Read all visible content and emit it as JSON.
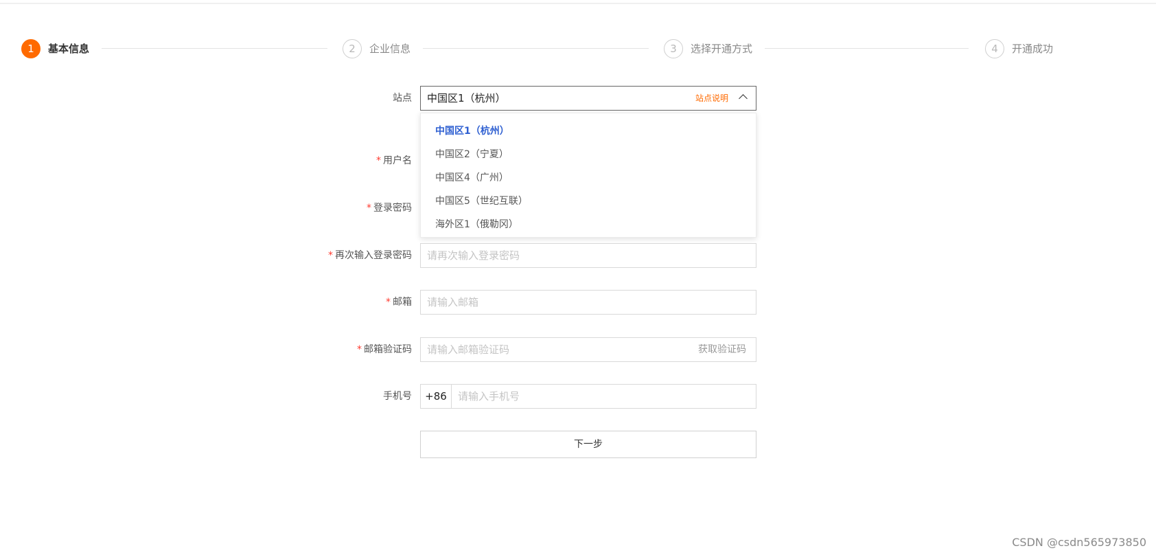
{
  "steps": [
    {
      "number": "1",
      "label": "基本信息"
    },
    {
      "number": "2",
      "label": "企业信息"
    },
    {
      "number": "3",
      "label": "选择开通方式"
    },
    {
      "number": "4",
      "label": "开通成功"
    }
  ],
  "colors": {
    "accent": "#ff6a00",
    "selected_option": "#2e5fd1"
  },
  "site": {
    "label": "站点",
    "value": "中国区1（杭州）",
    "help_link": "站点说明",
    "options": [
      "中国区1（杭州）",
      "中国区2（宁夏）",
      "中国区4（广州）",
      "中国区5（世纪互联）",
      "海外区1（俄勒冈）"
    ],
    "selected_index": 0
  },
  "fields": {
    "required_mark": "*",
    "username": {
      "label": "用户名"
    },
    "password": {
      "label": "登录密码"
    },
    "confirm_password": {
      "label": "再次输入登录密码",
      "placeholder": "请再次输入登录密码"
    },
    "email": {
      "label": "邮箱",
      "placeholder": "请输入邮箱"
    },
    "email_code": {
      "label": "邮箱验证码",
      "placeholder": "请输入邮箱验证码",
      "action": "获取验证码"
    },
    "phone": {
      "label": "手机号",
      "prefix": "+86",
      "placeholder": "请输入手机号"
    }
  },
  "next_button": "下一步",
  "watermark": "CSDN @csdn565973850"
}
